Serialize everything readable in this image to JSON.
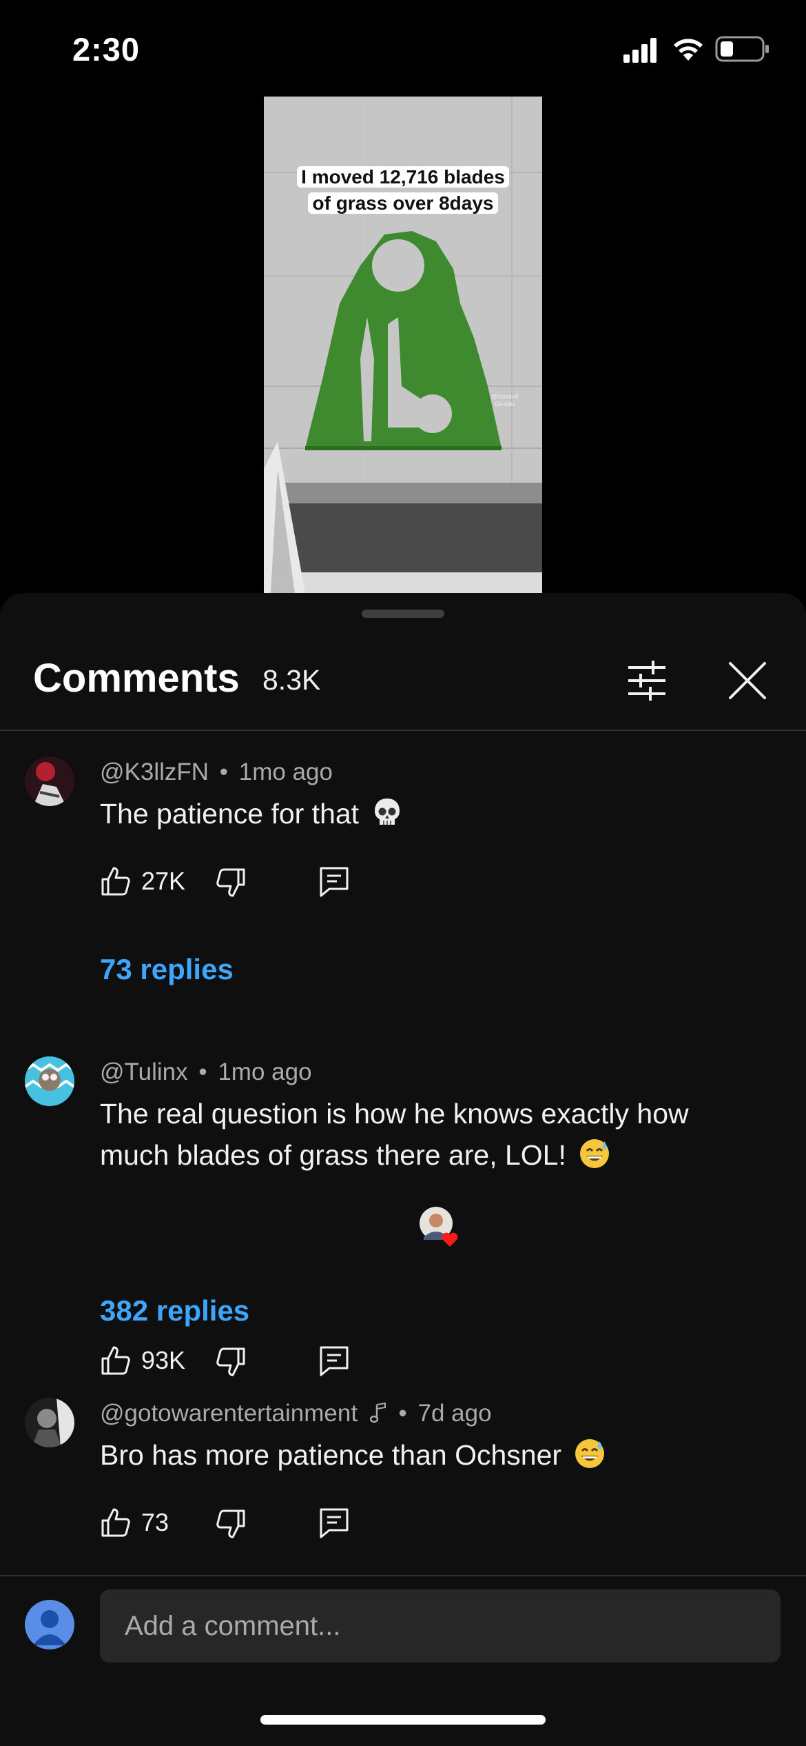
{
  "status_bar": {
    "time": "2:30"
  },
  "video": {
    "caption_line1": "I moved 12,716 blades",
    "caption_line2": "of grass over 8days",
    "watermark_line1": "@Samuel",
    "watermark_line2": "Grubbs"
  },
  "comments_panel": {
    "title": "Comments",
    "count": "8.3K",
    "comments": [
      {
        "handle": "@K3llzFN",
        "age": "1mo ago",
        "text": "The patience for that",
        "emoji": "skull-emoji",
        "likes": "27K",
        "replies": "73 replies"
      },
      {
        "handle": "@Tulinx",
        "age": "1mo ago",
        "text": "The real question is how he knows exactly how much blades of grass there are, LOL!",
        "emoji": "sweat-smile-emoji",
        "likes": "93K",
        "creator_hearted": true,
        "replies": "382 replies"
      },
      {
        "handle": "@gotowarentertainment",
        "handle_badge": "music-note-icon",
        "age": "7d ago",
        "text": "Bro has more patience than Ochsner",
        "emoji": "sweat-smile-emoji",
        "likes": "73"
      }
    ],
    "meta_separator": "•",
    "add_comment_placeholder": "Add a comment..."
  },
  "colors": {
    "background": "#0f0f0f",
    "link": "#3ea6ff",
    "secondary_text": "#aaaaaa",
    "input_bg": "#272727"
  }
}
